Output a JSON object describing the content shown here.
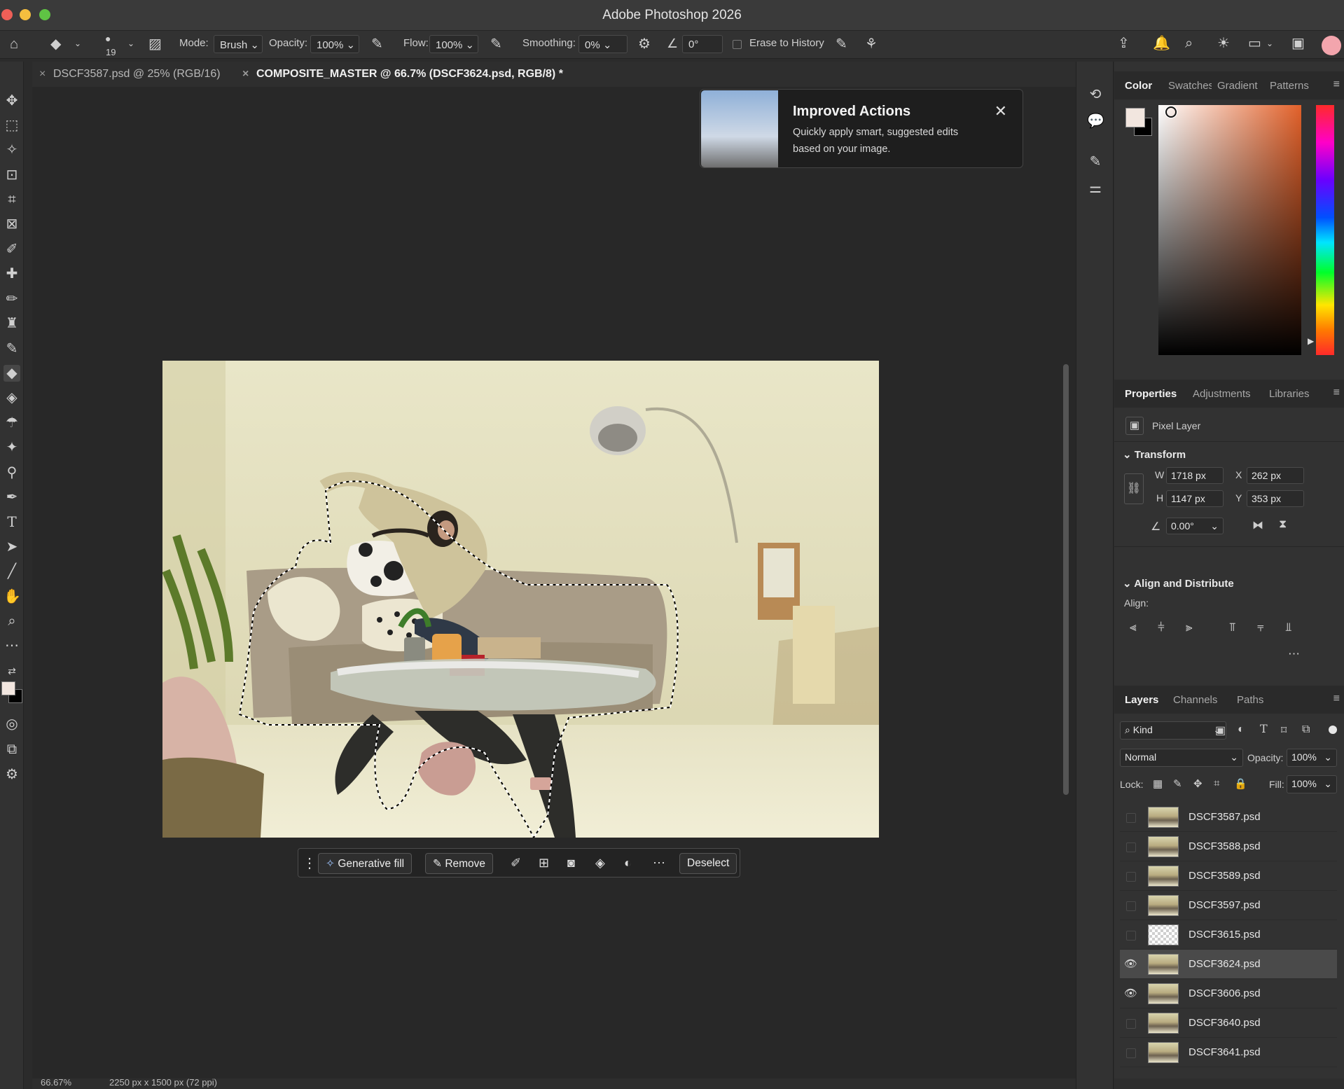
{
  "window": {
    "title": "Adobe Photoshop 2026"
  },
  "options_bar": {
    "brush_size": "19",
    "mode_label": "Mode:",
    "mode_value": "Brush",
    "opacity_label": "Opacity:",
    "opacity_value": "100%",
    "flow_label": "Flow:",
    "flow_value": "100%",
    "smoothing_label": "Smoothing:",
    "smoothing_value": "0%",
    "angle_value": "0°",
    "erase_to_history": "Erase to History"
  },
  "document_tabs": [
    {
      "label": "DSCF3587.psd @ 25% (RGB/16)"
    },
    {
      "label": "COMPOSITE_MASTER @ 66.7% (DSCF3624.psd, RGB/8) *"
    }
  ],
  "popup": {
    "title": "Improved Actions",
    "body": "Quickly apply smart, suggested edits based on your image."
  },
  "contextual_taskbar": {
    "generative_fill": "Generative fill",
    "remove": "Remove",
    "deselect": "Deselect"
  },
  "color_panel": {
    "tabs": [
      "Color",
      "Swatches",
      "Gradient",
      "Patterns"
    ],
    "foreground": "#f2e6df",
    "background": "#000000"
  },
  "properties_panel": {
    "tabs": [
      "Properties",
      "Adjustments",
      "Libraries"
    ],
    "layer_type": "Pixel Layer",
    "transform_title": "Transform",
    "w_label": "W",
    "w_value": "1718 px",
    "x_label": "X",
    "x_value": "262 px",
    "h_label": "H",
    "h_value": "1147 px",
    "y_label": "Y",
    "y_value": "353 px",
    "angle_value": "0.00°",
    "align_title": "Align and Distribute",
    "align_label": "Align:"
  },
  "layers_panel": {
    "tabs": [
      "Layers",
      "Channels",
      "Paths"
    ],
    "filter_kind": "Kind",
    "blend_mode": "Normal",
    "opacity_label": "Opacity:",
    "opacity_value": "100%",
    "lock_label": "Lock:",
    "fill_label": "Fill:",
    "fill_value": "100%",
    "layers": [
      {
        "name": "DSCF3587.psd",
        "visible": false,
        "selected": false
      },
      {
        "name": "DSCF3588.psd",
        "visible": false,
        "selected": false
      },
      {
        "name": "DSCF3589.psd",
        "visible": false,
        "selected": false
      },
      {
        "name": "DSCF3597.psd",
        "visible": false,
        "selected": false
      },
      {
        "name": "DSCF3615.psd",
        "visible": false,
        "selected": false
      },
      {
        "name": "DSCF3624.psd",
        "visible": true,
        "selected": true
      },
      {
        "name": "DSCF3606.psd",
        "visible": true,
        "selected": false
      },
      {
        "name": "DSCF3640.psd",
        "visible": false,
        "selected": false
      },
      {
        "name": "DSCF3641.psd",
        "visible": false,
        "selected": false
      }
    ]
  },
  "status": {
    "zoom": "66.67%",
    "doc_info": "2250 px x 1500 px (72 ppi)"
  }
}
